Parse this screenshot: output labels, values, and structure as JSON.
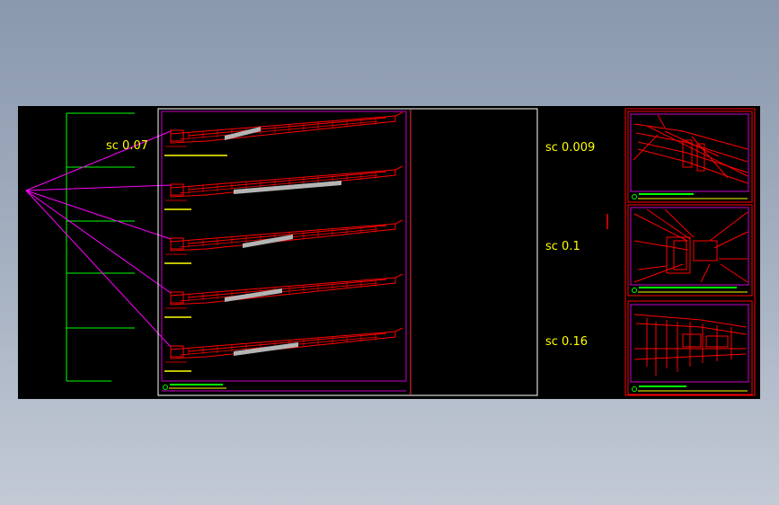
{
  "scale_labels": {
    "left": "sc  0.07",
    "mid_top": "sc  0.009",
    "mid_middle": "sc  0.1",
    "mid_bottom": "sc  0.16"
  },
  "colors": {
    "background": "#000000",
    "drawing": "#ff0000",
    "frame": "#cc00cc",
    "leader": "#ff00ff",
    "tree": "#00ff00",
    "text": "#ffff00",
    "fill": "#b4b4b4"
  },
  "section_count": 5
}
